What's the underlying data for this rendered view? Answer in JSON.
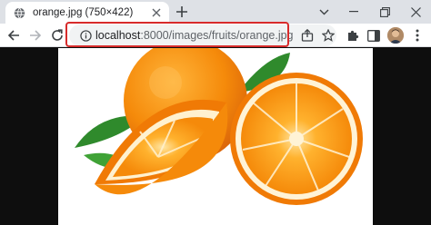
{
  "tab": {
    "title": "orange.jpg (750×422)",
    "favicon": "globe-icon",
    "close_icon": "close-icon"
  },
  "tabstrip": {
    "new_tab_icon": "plus-icon",
    "tab_search_icon": "chevron-down-icon",
    "window_controls": [
      "minimize-icon",
      "restore-icon",
      "close-icon"
    ]
  },
  "toolbar": {
    "back_icon": "arrow-left-icon",
    "forward_icon": "arrow-right-icon",
    "reload_icon": "reload-icon",
    "omnibox": {
      "host": "localhost",
      "path": ":8000/images/fruits/orange.jpg",
      "info_icon": "info-icon",
      "share_icon": "share-icon",
      "bookmark_icon": "star-icon"
    },
    "extensions_icon": "puzzle-icon",
    "sidepanel_icon": "side-panel-icon",
    "menu_icon": "kebab-menu-icon",
    "highlight_color": "#d72b2b"
  },
  "content": {
    "image_subject": "oranges",
    "background_color": "#0e0e0e"
  }
}
